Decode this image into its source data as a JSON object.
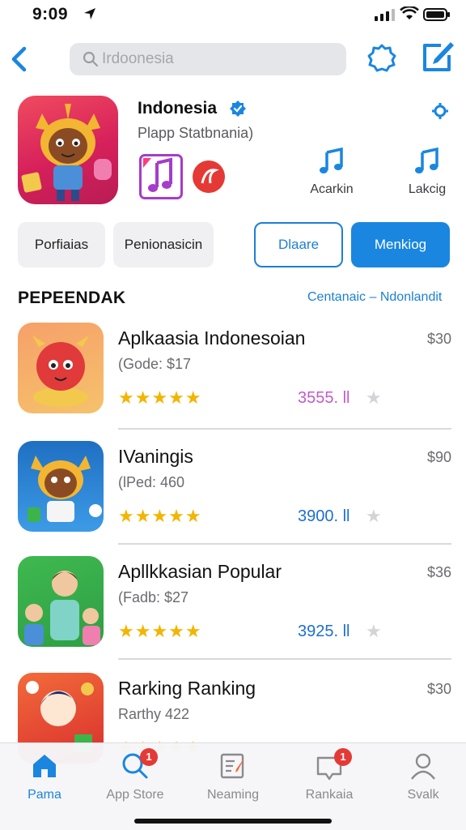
{
  "status_bar": {
    "time": "9:09"
  },
  "top_nav": {
    "search_placeholder": "Irdoonesia"
  },
  "featured": {
    "title": "Indonesia",
    "subtitle": "Plapp Statbnania)",
    "actions": [
      {
        "label": "Acarkin",
        "icon": "music-note-icon"
      },
      {
        "label": "Lakcig",
        "icon": "music-note-icon"
      }
    ]
  },
  "buttons": [
    {
      "label": "Porfiaias",
      "style": "grey"
    },
    {
      "label": "Penionasicin",
      "style": "grey"
    },
    {
      "label": "Dlaare",
      "style": "outline"
    },
    {
      "label": "Menkiog",
      "style": "solid"
    }
  ],
  "section": {
    "title": "PEPEENDAK",
    "link": "Centanaic – Ndonlandit"
  },
  "apps": [
    {
      "name": "Aplkaasia Indonesoian",
      "sub": "(Gode: $17",
      "price": "$30",
      "rating": "3555. ll",
      "rating_color": "#c25bc9",
      "stars": "★★★★★",
      "icon": "red-mascot-icon"
    },
    {
      "name": "IVaningis",
      "sub": "(lPed: 460",
      "price": "$90",
      "rating": "3900. ll",
      "rating_color": "#1c6fd0",
      "stars": "★★★★★",
      "icon": "deer-mascot-icon"
    },
    {
      "name": "Apllkkasian Popular",
      "sub": "(Fadb: $27",
      "price": "$36",
      "rating": "3925. ll",
      "rating_color": "#1c6fd0",
      "stars": "★★★★★",
      "icon": "family-icon"
    },
    {
      "name": "Rarking Ranking",
      "sub": "Rarthy 422",
      "price": "$30",
      "rating": "",
      "rating_color": "#1c6fd0",
      "stars": "★★★★★",
      "icon": "character-icon"
    }
  ],
  "tabbar": {
    "tabs": [
      {
        "label": "Pama",
        "icon": "home-icon",
        "active": true
      },
      {
        "label": "App Store",
        "icon": "search-icon",
        "badge": "1"
      },
      {
        "label": "Neaming",
        "icon": "notepad-icon"
      },
      {
        "label": "Rankaia",
        "icon": "inbox-icon",
        "badge": "1"
      },
      {
        "label": "Svalk",
        "icon": "person-icon"
      }
    ]
  },
  "colors": {
    "accent": "#1a86e0",
    "star": "#f4b400",
    "badge": "#e53935"
  }
}
